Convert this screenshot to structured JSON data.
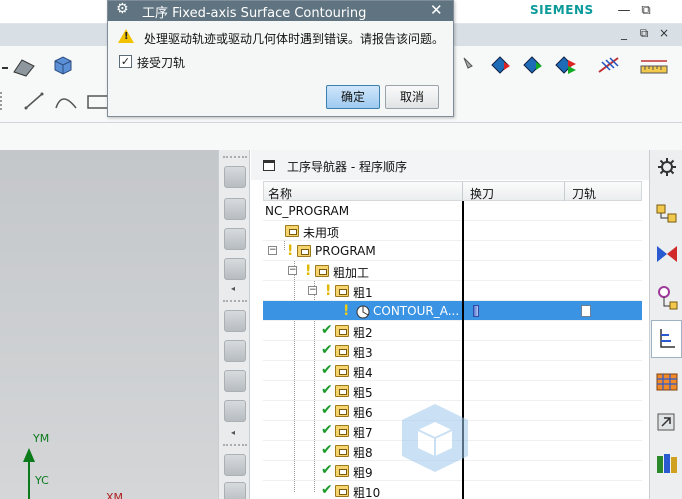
{
  "titlebar": {
    "brand": "SIEMENS",
    "minimize_glyph": "—",
    "restore_glyph": "⧉",
    "inner_minimize_glyph": "_",
    "inner_restore_glyph": "⧉",
    "inner_close_glyph": "×"
  },
  "dialog": {
    "title": "工序  Fixed-axis Surface Contouring",
    "gear_icon": "⚙",
    "close_glyph": "✕",
    "message": "处理驱动轨迹或驱动几何体时遇到错误。请报告该问题。",
    "checkbox_label": "接受刀轨",
    "checkbox_checked": true,
    "check_glyph": "✓",
    "warning_excl": "!",
    "ok_label": "确定",
    "cancel_label": "取消"
  },
  "navigator": {
    "title": "工序导航器 - 程序顺序",
    "columns": [
      "名称",
      "换刀",
      "刀轨"
    ],
    "rows": [
      {
        "label": "NC_PROGRAM",
        "status": "none",
        "folder": false
      },
      {
        "label": "未用项",
        "status": "none",
        "folder": true
      },
      {
        "label": "PROGRAM",
        "status": "bulb",
        "folder": true
      },
      {
        "label": "粗加工",
        "status": "bulb",
        "folder": true
      },
      {
        "label": "粗1",
        "status": "bulb",
        "folder": true
      },
      {
        "label": "CONTOUR_A...",
        "status": "bulb",
        "folder": false,
        "selected": true
      },
      {
        "label": "粗2",
        "status": "check",
        "folder": true
      },
      {
        "label": "粗3",
        "status": "check",
        "folder": true
      },
      {
        "label": "粗4",
        "status": "check",
        "folder": true
      },
      {
        "label": "粗5",
        "status": "check",
        "folder": true
      },
      {
        "label": "粗6",
        "status": "check",
        "folder": true
      },
      {
        "label": "粗7",
        "status": "check",
        "folder": true
      },
      {
        "label": "粗8",
        "status": "check",
        "folder": true
      },
      {
        "label": "粗9",
        "status": "check",
        "folder": true
      },
      {
        "label": "粗10",
        "status": "check",
        "folder": true
      }
    ],
    "glyphs": {
      "bulb": "!",
      "check": "✔",
      "collapse": "−"
    }
  },
  "graphics": {
    "axis_y1": "YM",
    "axis_y2": "YC",
    "axis_x": "XM"
  },
  "colors": {
    "brand": "#0a9a9a",
    "dialog_title_bar": "#5f7480",
    "selection": "#3b93e3",
    "check_green": "#1a9a2a",
    "bulb_yellow": "#e0b800",
    "axis_green": "#0b7a1b"
  },
  "icons": {
    "gear": "gear-icon",
    "warning": "warning-icon",
    "folder": "folder-icon",
    "bulb": "warning-bulb-icon",
    "check": "check-icon"
  }
}
